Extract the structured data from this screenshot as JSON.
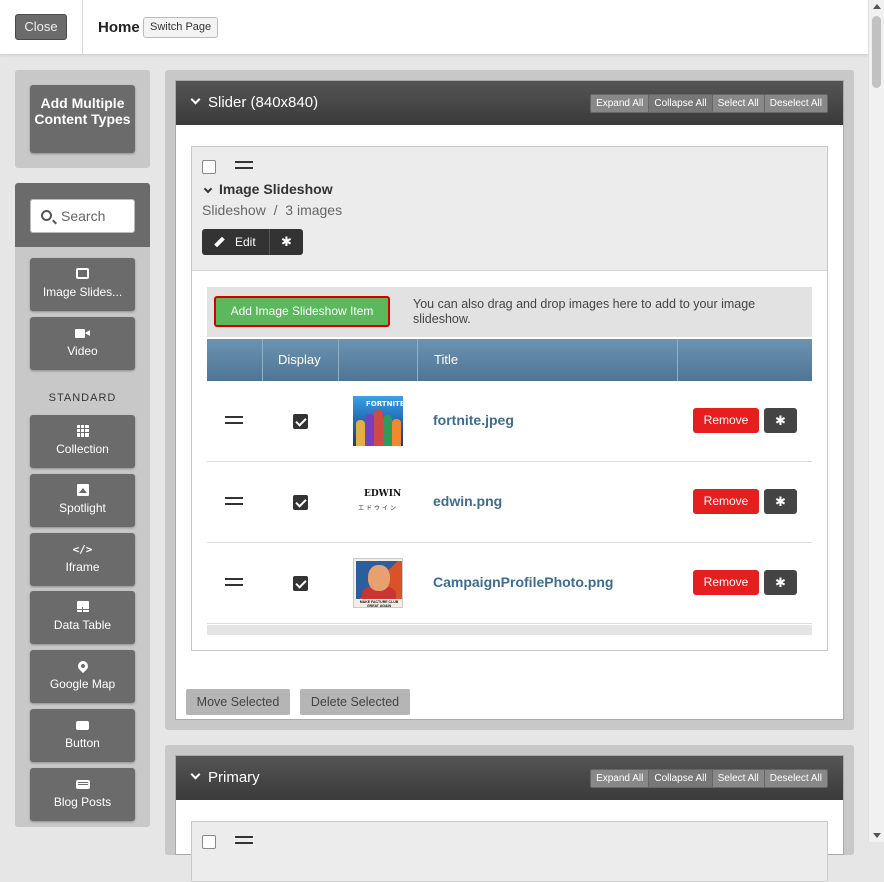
{
  "topbar": {
    "close_label": "Close",
    "page_title": "Home",
    "switch_page_label": "Switch Page"
  },
  "sidebar": {
    "add_multiple_label": "Add Multiple Content Types",
    "search_placeholder": "Search",
    "top_items": [
      {
        "label": "Image Slides...",
        "icon": "image-icon"
      },
      {
        "label": "Video",
        "icon": "video-icon"
      }
    ],
    "section_label": "STANDARD",
    "standard_items": [
      {
        "label": "Collection",
        "icon": "grid-icon"
      },
      {
        "label": "Spotlight",
        "icon": "picture-icon"
      },
      {
        "label": "Iframe",
        "icon": "code-icon"
      },
      {
        "label": "Data Table",
        "icon": "table-icon"
      },
      {
        "label": "Google Map",
        "icon": "map-pin-icon"
      },
      {
        "label": "Button",
        "icon": "button-icon"
      },
      {
        "label": "Blog Posts",
        "icon": "keyboard-icon"
      }
    ]
  },
  "sections": [
    {
      "title": "Slider (840x840)",
      "header_buttons": [
        "Expand All",
        "Collapse All",
        "Select All",
        "Deselect All"
      ]
    },
    {
      "title": "Primary",
      "header_buttons": [
        "Expand All",
        "Collapse All",
        "Select All",
        "Deselect All"
      ]
    }
  ],
  "block": {
    "title": "Image Slideshow",
    "type": "Slideshow",
    "separator": "/",
    "count": "3 images",
    "edit_label": "Edit",
    "add_item_label": "Add Image Slideshow Item",
    "drag_note": "You can also drag and drop images here to add to your image slideshow.",
    "columns": [
      "Display",
      "Title"
    ],
    "rows": [
      {
        "name": "fortnite.jpeg",
        "display": true,
        "remove_label": "Remove",
        "thumb_text": "FORTNITE"
      },
      {
        "name": "edwin.png",
        "display": true,
        "remove_label": "Remove",
        "thumb_text": "EDWIN",
        "thumb_subtext": "エドウイン"
      },
      {
        "name": "CampaignProfilePhoto.png",
        "display": true,
        "remove_label": "Remove",
        "thumb_text": "MAKE FACTURE CLUB GREAT AGAIN"
      }
    ]
  },
  "footer_buttons": {
    "move_label": "Move Selected",
    "delete_label": "Delete Selected"
  },
  "colors": {
    "accent_green": "#5cb85c",
    "remove_red": "#e61e1e",
    "title_blue": "#3d6d90",
    "table_header": "#5b81a1"
  }
}
